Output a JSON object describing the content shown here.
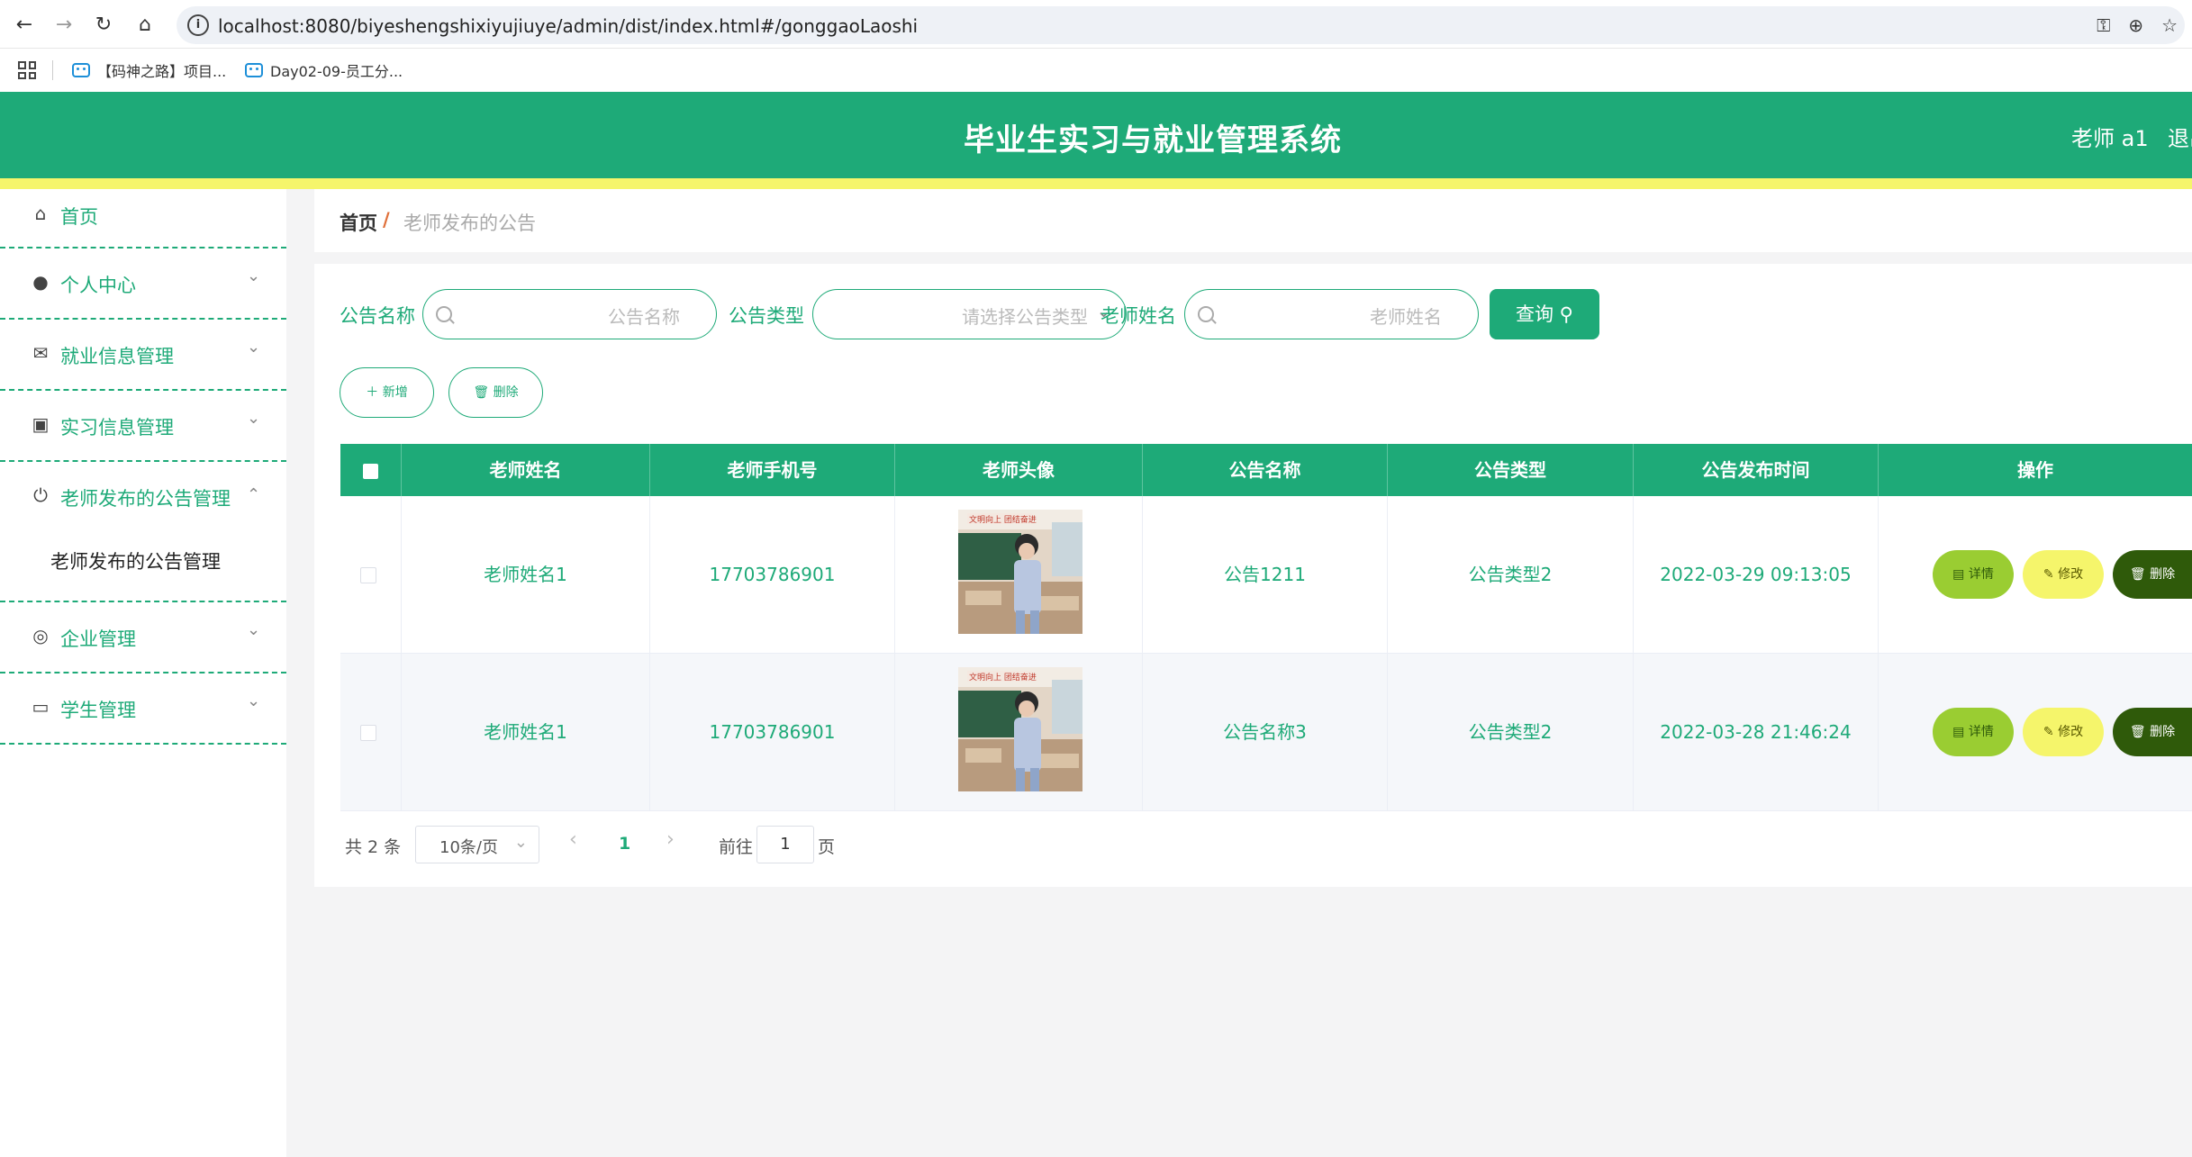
{
  "browser": {
    "url": "localhost:8080/biyeshengshixiyujiuye/admin/dist/index.html#/gonggaoLaoshi",
    "bookmarks": [
      "【码神之路】项目...",
      "Day02-09-员工分..."
    ]
  },
  "header": {
    "title": "毕业生实习与就业管理系统",
    "user": "老师 a1",
    "logout": "退出"
  },
  "sidebar": {
    "items": [
      {
        "label": "首页",
        "icon": "home-icon"
      },
      {
        "label": "个人中心",
        "icon": "user-icon"
      },
      {
        "label": "就业信息管理",
        "icon": "mail-icon"
      },
      {
        "label": "实习信息管理",
        "icon": "wallet-icon"
      },
      {
        "label": "老师发布的公告管理",
        "icon": "power-icon"
      },
      {
        "label": "企业管理",
        "icon": "lifebuoy-icon"
      },
      {
        "label": "学生管理",
        "icon": "chat-icon"
      }
    ],
    "submenu": "老师发布的公告管理"
  },
  "breadcrumb": {
    "home": "首页",
    "separator": "/",
    "current": "老师发布的公告"
  },
  "filters": {
    "name_label": "公告名称",
    "name_placeholder": "公告名称",
    "type_label": "公告类型",
    "type_placeholder": "请选择公告类型",
    "teacher_label": "老师姓名",
    "teacher_placeholder": "老师姓名",
    "query": "查询"
  },
  "actions": {
    "add": "新增",
    "delete": "删除"
  },
  "table": {
    "headers": [
      "老师姓名",
      "老师手机号",
      "老师头像",
      "公告名称",
      "公告类型",
      "公告发布时间",
      "操作"
    ],
    "rows": [
      {
        "teacher": "老师姓名1",
        "phone": "17703786901",
        "name": "公告1211",
        "type": "公告类型2",
        "time": "2022-03-29 09:13:05"
      },
      {
        "teacher": "老师姓名1",
        "phone": "17703786901",
        "name": "公告名称3",
        "type": "公告类型2",
        "time": "2022-03-28 21:46:24"
      }
    ],
    "op": {
      "detail": "详情",
      "edit": "修改",
      "delete": "删除"
    }
  },
  "pagination": {
    "total": "共 2 条",
    "size": "10条/页",
    "current": "1",
    "goto": "前往",
    "goto_value": "1",
    "page_suffix": "页"
  },
  "colors": {
    "primary": "#1eaa78",
    "accent_yellow": "#f5f56b",
    "detail_btn": "#9acd32",
    "edit_btn": "#f5f56b",
    "delete_btn": "#2f5a0a"
  }
}
